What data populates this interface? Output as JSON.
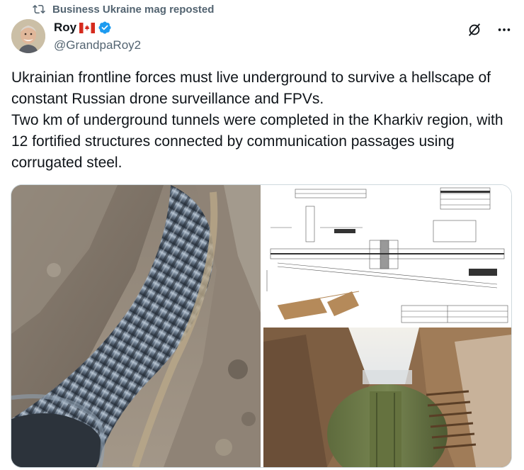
{
  "repost": {
    "label": "Business Ukraine mag reposted",
    "icon": "repost-icon"
  },
  "author": {
    "name": "Roy",
    "flag": "canada-flag",
    "verified": true,
    "handle": "@GrandpaRoy2"
  },
  "actions": {
    "grok_icon": "grok-icon",
    "more_icon": "more-icon"
  },
  "tweet": {
    "paragraph1": "Ukrainian frontline forces must live underground to survive a hellscape of constant Russian drone surveillance and FPVs.",
    "paragraph2": "Two km of underground tunnels were completed in the Kharkiv region, with 12 fortified structures connected by communication passages using corrugated steel."
  },
  "media": {
    "images": [
      {
        "name": "corrugated-steel-tunnel-photo"
      },
      {
        "name": "construction-blueprint-drawing"
      },
      {
        "name": "trench-bunker-entrance-photo"
      }
    ]
  },
  "colors": {
    "text": "#0f1419",
    "secondary": "#536471",
    "verified_blue": "#1d9bf0",
    "border": "#cfd9de"
  }
}
